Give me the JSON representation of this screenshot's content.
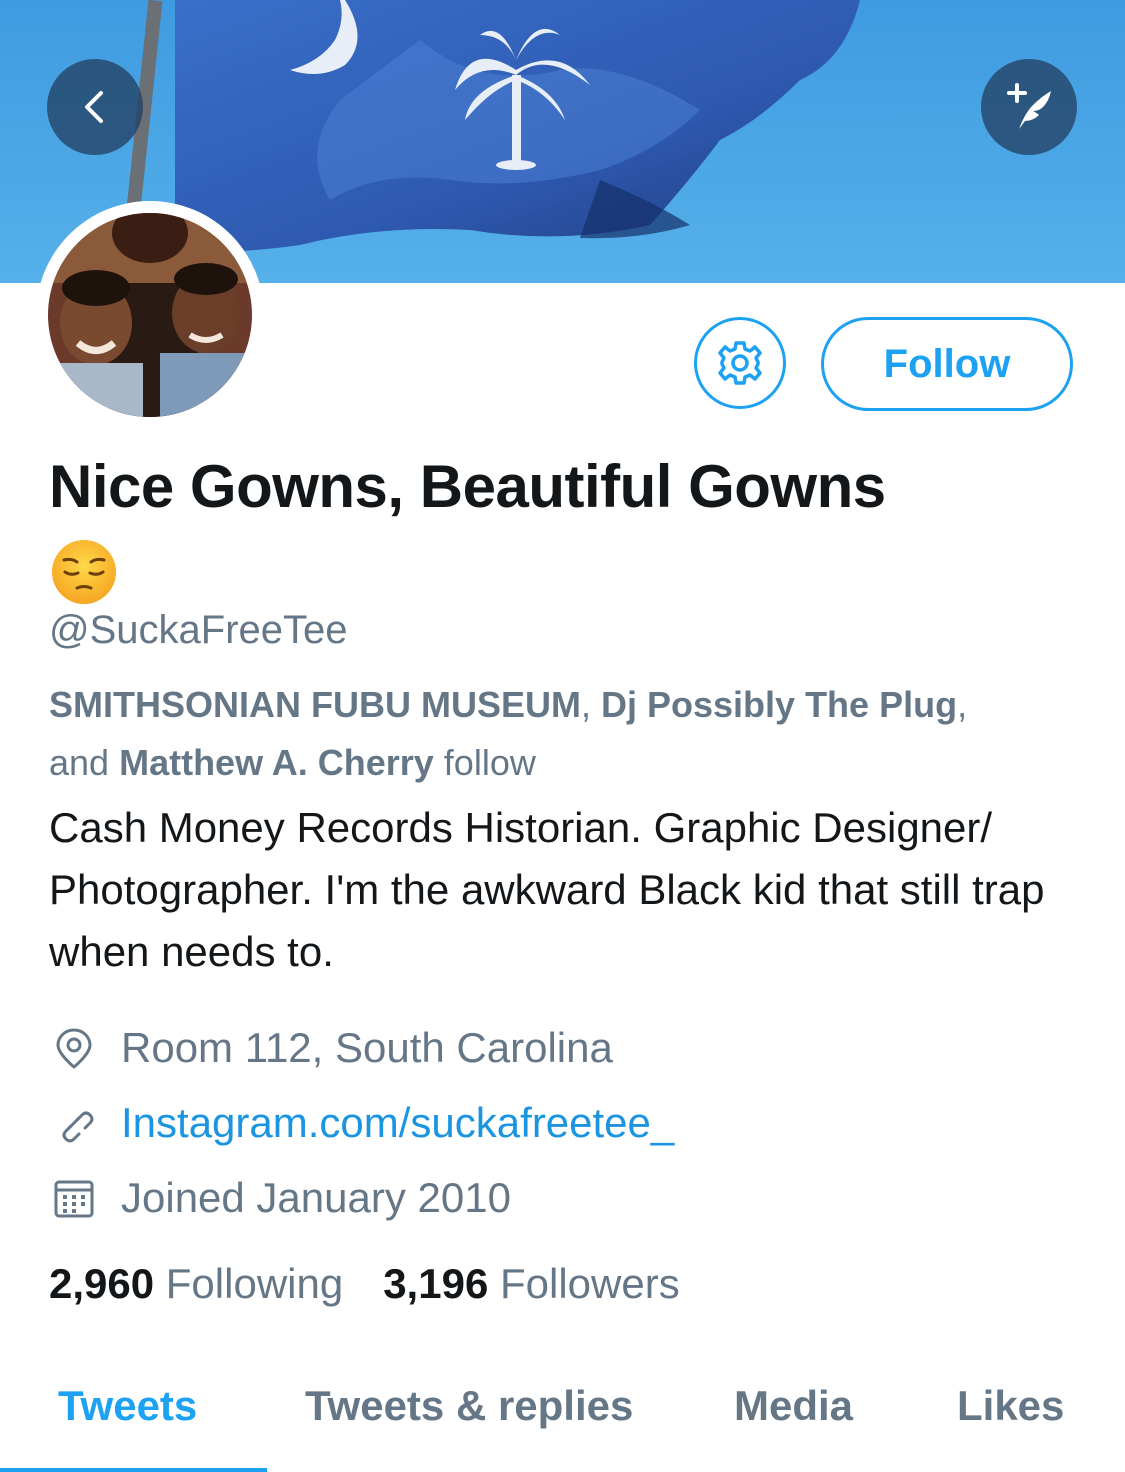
{
  "header": {
    "back_icon": "chevron-left-icon",
    "compose_icon": "compose-tweet-icon"
  },
  "profile": {
    "display_name": "Nice Gowns, Beautiful Gowns",
    "name_emoji": "pensive-face-emoji",
    "handle": "@SuckaFreeTee",
    "follow_label": "Follow",
    "settings_icon": "gear-icon"
  },
  "followed_by": {
    "names": [
      "SMITHSONIAN FUBU MUSEUM",
      "Dj Possibly The Plug",
      "Matthew A. Cherry"
    ],
    "sep1": ", ",
    "sep2": ",",
    "and": "and ",
    "suffix": " follow"
  },
  "bio": {
    "text": "Cash Money Records Historian. Graphic Designer/ Photographer. I'm the awkward Black kid that still trap when needs to."
  },
  "meta": {
    "location": "Room 112, South Carolina",
    "website": "Instagram.com/suckafreetee_",
    "joined": "Joined January 2010"
  },
  "stats": {
    "following_count": "2,960",
    "following_label": "Following",
    "followers_count": "3,196",
    "followers_label": "Followers"
  },
  "tabs": [
    {
      "label": "Tweets",
      "active": true
    },
    {
      "label": "Tweets & replies",
      "active": false
    },
    {
      "label": "Media",
      "active": false
    },
    {
      "label": "Likes",
      "active": false
    }
  ],
  "colors": {
    "accent": "#1da1f2",
    "link": "#1b95e0",
    "secondary_text": "#657786",
    "primary_text": "#14171a"
  }
}
